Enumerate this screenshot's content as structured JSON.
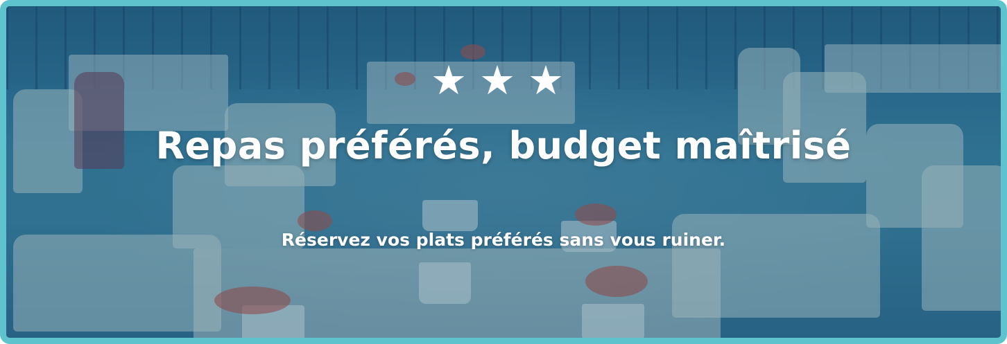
{
  "banner": {
    "rating_stars": 3,
    "star_icon": "star-icon",
    "headline": "Repas préférés, budget maîtrisé",
    "subheadline": "Réservez vos plats préférés sans vous ruiner.",
    "colors": {
      "border": "#5ec3cc",
      "overlay": "#2a5f82",
      "text": "#ffffff"
    }
  }
}
